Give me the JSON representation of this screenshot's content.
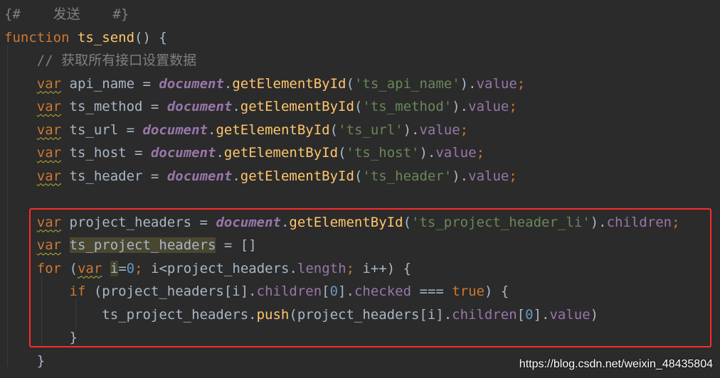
{
  "editor": {
    "lines": [
      {
        "tokens": [
          {
            "t": "{#    发送    #}",
            "c": "tpl"
          }
        ]
      },
      {
        "tokens": [
          {
            "t": "function ",
            "c": "kw"
          },
          {
            "t": "ts_send",
            "c": "fn"
          },
          {
            "t": "() {",
            "c": "plain"
          }
        ]
      },
      {
        "tokens": [
          {
            "t": "    // 获取所有接口设置数据",
            "c": "cmt"
          }
        ]
      },
      {
        "tokens": [
          {
            "t": "    ",
            "c": "plain"
          },
          {
            "t": "var",
            "c": "kw",
            "s": 1
          },
          {
            "t": " api_name = ",
            "c": "plain"
          },
          {
            "t": "document",
            "c": "glob"
          },
          {
            "t": ".",
            "c": "plain"
          },
          {
            "t": "getElementById",
            "c": "meth"
          },
          {
            "t": "(",
            "c": "plain"
          },
          {
            "t": "'ts_api_name'",
            "c": "str"
          },
          {
            "t": ").",
            "c": "plain"
          },
          {
            "t": "value",
            "c": "prop"
          },
          {
            "t": ";",
            "c": "kw"
          }
        ]
      },
      {
        "tokens": [
          {
            "t": "    ",
            "c": "plain"
          },
          {
            "t": "var",
            "c": "kw",
            "s": 1
          },
          {
            "t": " ts_method = ",
            "c": "plain"
          },
          {
            "t": "document",
            "c": "glob"
          },
          {
            "t": ".",
            "c": "plain"
          },
          {
            "t": "getElementById",
            "c": "meth"
          },
          {
            "t": "(",
            "c": "plain"
          },
          {
            "t": "'ts_method'",
            "c": "str"
          },
          {
            "t": ").",
            "c": "plain"
          },
          {
            "t": "value",
            "c": "prop"
          },
          {
            "t": ";",
            "c": "kw"
          }
        ]
      },
      {
        "tokens": [
          {
            "t": "    ",
            "c": "plain"
          },
          {
            "t": "var",
            "c": "kw",
            "s": 1
          },
          {
            "t": " ts_url = ",
            "c": "plain"
          },
          {
            "t": "document",
            "c": "glob"
          },
          {
            "t": ".",
            "c": "plain"
          },
          {
            "t": "getElementById",
            "c": "meth"
          },
          {
            "t": "(",
            "c": "plain"
          },
          {
            "t": "'ts_url'",
            "c": "str"
          },
          {
            "t": ").",
            "c": "plain"
          },
          {
            "t": "value",
            "c": "prop"
          },
          {
            "t": ";",
            "c": "kw"
          }
        ]
      },
      {
        "tokens": [
          {
            "t": "    ",
            "c": "plain"
          },
          {
            "t": "var",
            "c": "kw",
            "s": 1
          },
          {
            "t": " ts_host = ",
            "c": "plain"
          },
          {
            "t": "document",
            "c": "glob"
          },
          {
            "t": ".",
            "c": "plain"
          },
          {
            "t": "getElementById",
            "c": "meth"
          },
          {
            "t": "(",
            "c": "plain"
          },
          {
            "t": "'ts_host'",
            "c": "str"
          },
          {
            "t": ").",
            "c": "plain"
          },
          {
            "t": "value",
            "c": "prop"
          },
          {
            "t": ";",
            "c": "kw"
          }
        ]
      },
      {
        "tokens": [
          {
            "t": "    ",
            "c": "plain"
          },
          {
            "t": "var",
            "c": "kw",
            "s": 1
          },
          {
            "t": " ts_header = ",
            "c": "plain"
          },
          {
            "t": "document",
            "c": "glob"
          },
          {
            "t": ".",
            "c": "plain"
          },
          {
            "t": "getElementById",
            "c": "meth"
          },
          {
            "t": "(",
            "c": "plain"
          },
          {
            "t": "'ts_header'",
            "c": "str"
          },
          {
            "t": ").",
            "c": "plain"
          },
          {
            "t": "value",
            "c": "prop"
          },
          {
            "t": ";",
            "c": "kw"
          }
        ]
      },
      {
        "tokens": []
      },
      {
        "tokens": [
          {
            "t": "    ",
            "c": "plain"
          },
          {
            "t": "var",
            "c": "kw",
            "s": 1
          },
          {
            "t": " project_headers = ",
            "c": "plain"
          },
          {
            "t": "document",
            "c": "glob"
          },
          {
            "t": ".",
            "c": "plain"
          },
          {
            "t": "getElementById",
            "c": "meth"
          },
          {
            "t": "(",
            "c": "plain"
          },
          {
            "t": "'ts_project_header_li'",
            "c": "str"
          },
          {
            "t": ").",
            "c": "plain"
          },
          {
            "t": "children",
            "c": "prop"
          },
          {
            "t": ";",
            "c": "kw"
          }
        ]
      },
      {
        "tokens": [
          {
            "t": "    ",
            "c": "plain"
          },
          {
            "t": "var",
            "c": "kw",
            "s": 1
          },
          {
            "t": " ",
            "c": "plain"
          },
          {
            "t": "ts_project_headers",
            "c": "plain",
            "h": "ident-hl"
          },
          {
            "t": " = []",
            "c": "plain"
          }
        ]
      },
      {
        "tokens": [
          {
            "t": "    ",
            "c": "plain"
          },
          {
            "t": "for",
            "c": "kw"
          },
          {
            "t": " (",
            "c": "plain"
          },
          {
            "t": "var",
            "c": "kw",
            "s": 1
          },
          {
            "t": " ",
            "c": "plain"
          },
          {
            "t": "i",
            "c": "plain",
            "h": "caret-hl"
          },
          {
            "t": "=",
            "c": "plain"
          },
          {
            "t": "0",
            "c": "num"
          },
          {
            "t": "; ",
            "c": "kw"
          },
          {
            "t": "i<project_headers.",
            "c": "plain"
          },
          {
            "t": "length",
            "c": "prop"
          },
          {
            "t": "; ",
            "c": "kw"
          },
          {
            "t": "i++) {",
            "c": "plain"
          }
        ]
      },
      {
        "tokens": [
          {
            "t": "        ",
            "c": "plain"
          },
          {
            "t": "if",
            "c": "kw"
          },
          {
            "t": " (project_headers[i].",
            "c": "plain"
          },
          {
            "t": "children",
            "c": "prop"
          },
          {
            "t": "[",
            "c": "plain"
          },
          {
            "t": "0",
            "c": "num"
          },
          {
            "t": "].",
            "c": "plain"
          },
          {
            "t": "checked",
            "c": "prop"
          },
          {
            "t": " === ",
            "c": "plain"
          },
          {
            "t": "true",
            "c": "kw"
          },
          {
            "t": ") {",
            "c": "plain"
          }
        ]
      },
      {
        "tokens": [
          {
            "t": "            ts_project_headers.",
            "c": "plain"
          },
          {
            "t": "push",
            "c": "meth"
          },
          {
            "t": "(project_headers[i].",
            "c": "plain"
          },
          {
            "t": "children",
            "c": "prop"
          },
          {
            "t": "[",
            "c": "plain"
          },
          {
            "t": "0",
            "c": "num"
          },
          {
            "t": "].",
            "c": "plain"
          },
          {
            "t": "value",
            "c": "prop"
          },
          {
            "t": ")",
            "c": "plain"
          }
        ]
      },
      {
        "tokens": [
          {
            "t": "        }",
            "c": "plain"
          }
        ]
      },
      {
        "tokens": [
          {
            "t": "    }",
            "c": "plain"
          }
        ]
      }
    ]
  },
  "watermark": "https://blog.csdn.net/weixin_48435804"
}
